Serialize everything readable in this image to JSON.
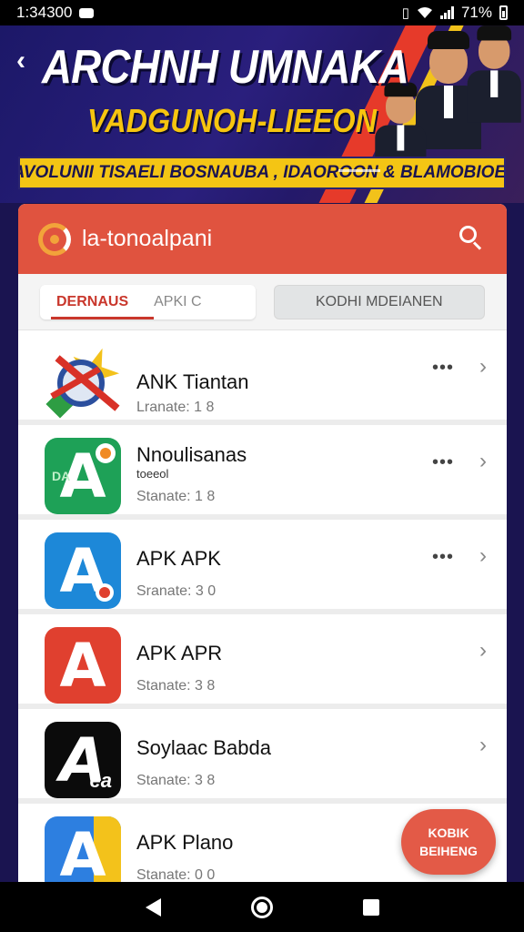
{
  "status_bar": {
    "time": "1:34300",
    "battery": "71%"
  },
  "banner": {
    "back_label": "‹",
    "title": "ARCHNH UMNAKA",
    "subtitle": "VADGUNOH-LIEEON",
    "strip_text": "AVOLUNII TISAELI BOSNAUBA , IDAOROON & BLAMOBIOE!"
  },
  "app": {
    "title": "la-tonoalpani",
    "tabs": {
      "active": "DERNAUS",
      "inactive": "APKI C",
      "filter": "KODHI MDEIANEN"
    },
    "items": [
      {
        "name": "ANK Tiantan",
        "sub": "",
        "status": "Lranate: 1 8",
        "dots": "•••",
        "chev": "›",
        "icon": "compass-icon"
      },
      {
        "name": "Nnoulisanas",
        "sub": "toeeol",
        "status": "Stanate: 1 8",
        "dots": "•••",
        "chev": "›",
        "icon": "apk-green-icon"
      },
      {
        "name": "APK APK",
        "sub": "",
        "status": "Sranate: 3 0",
        "dots": "•••",
        "chev": "›",
        "icon": "apk-blue-icon"
      },
      {
        "name": "APK APR",
        "sub": "",
        "status": "Stanate: 3 8",
        "dots": "",
        "chev": "›",
        "icon": "apk-red-icon"
      },
      {
        "name": "Soylaac Babda",
        "sub": "",
        "status": "Stanate: 3 8",
        "dots": "",
        "chev": "›",
        "icon": "apk-black-icon"
      },
      {
        "name": "APK Plano",
        "sub": "",
        "status": "Stanate: 0 0",
        "dots": "",
        "chev": "",
        "icon": "apk-plano-icon"
      }
    ],
    "fab": {
      "line1": "KOBIK",
      "line2": "BEIHENG"
    }
  },
  "colors": {
    "header": "#e0533f",
    "accent": "#c9372c",
    "banner_bg": "#1c1868",
    "banner_yellow": "#f4c514"
  }
}
